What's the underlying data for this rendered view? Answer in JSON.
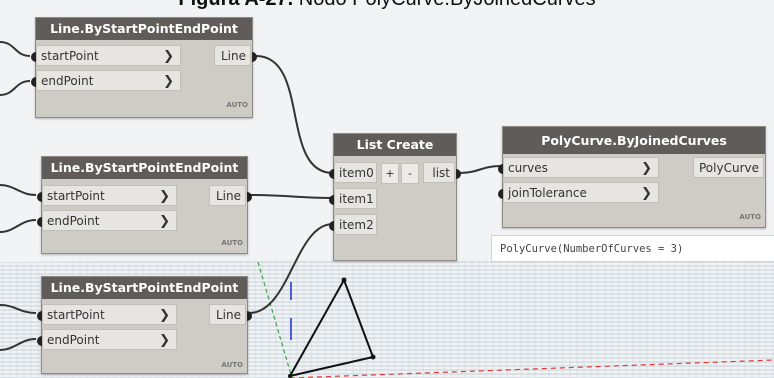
{
  "caption": {
    "prefix": "Figura A-27.",
    "text": "Nodo PolyCurve.ByJoinedCurves"
  },
  "nodes": {
    "line1": {
      "title": "Line.ByStartPointEndPoint",
      "in1": "startPoint",
      "in2": "endPoint",
      "out": "Line",
      "lacing": "AUTO"
    },
    "line2": {
      "title": "Line.ByStartPointEndPoint",
      "in1": "startPoint",
      "in2": "endPoint",
      "out": "Line",
      "lacing": "AUTO"
    },
    "line3": {
      "title": "Line.ByStartPointEndPoint",
      "in1": "startPoint",
      "in2": "endPoint",
      "out": "Line",
      "lacing": "AUTO"
    },
    "list": {
      "title": "List Create",
      "item0": "item0",
      "item1": "item1",
      "item2": "item2",
      "plus": "+",
      "minus": "-",
      "out": "list"
    },
    "poly": {
      "title": "PolyCurve.ByJoinedCurves",
      "in1": "curves",
      "in2": "joinTolerance",
      "out": "PolyCurve",
      "lacing": "AUTO"
    }
  },
  "preview": {
    "text": "PolyCurve(NumberOfCurves = 3)"
  },
  "colors": {
    "node_header": "#5f5c59",
    "node_body": "#cfccc5",
    "wire": "#333333",
    "grid": "#b8c6d2",
    "triangle": "#111111",
    "axis_red": "#e03a3a",
    "axis_green": "#3aa04a",
    "axis_blue": "#2a3bd8"
  },
  "icons": {
    "chevron": "chevron-right-icon"
  }
}
